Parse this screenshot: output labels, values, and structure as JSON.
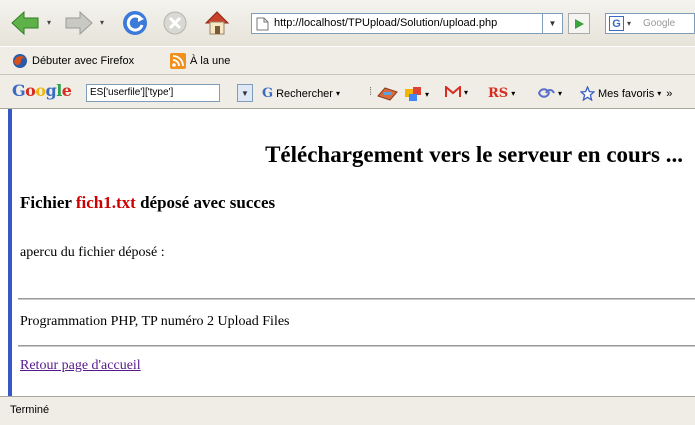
{
  "navbar": {
    "url": "http://localhost/TPUpload/Solution/upload.php",
    "search_placeholder": "Google"
  },
  "bookmarks": {
    "items": [
      {
        "label": "Débuter avec Firefox",
        "icon": "firefox-icon"
      },
      {
        "label": "À la une",
        "icon": "rss-icon"
      }
    ]
  },
  "google_toolbar": {
    "logo": "Google",
    "search_value": "ES['userfile']['type']",
    "search_button_label": "Rechercher",
    "favorites_label": "Mes favoris",
    "overflow_label": "»"
  },
  "page": {
    "heading": "Téléchargement vers le serveur en cours ...",
    "file_prefix": "Fichier",
    "file_name": "fich1.txt",
    "file_suffix": "déposé avec succes",
    "preview_label": "apercu du fichier déposé :",
    "footer_text": "Programmation PHP, TP numéro 2 Upload Files",
    "back_link": "Retour page d'accueil"
  },
  "status": {
    "text": "Terminé"
  },
  "colors": {
    "accent_blue": "#3658c6",
    "file_name_red": "#cc0000",
    "visited_link": "#551a8b"
  }
}
